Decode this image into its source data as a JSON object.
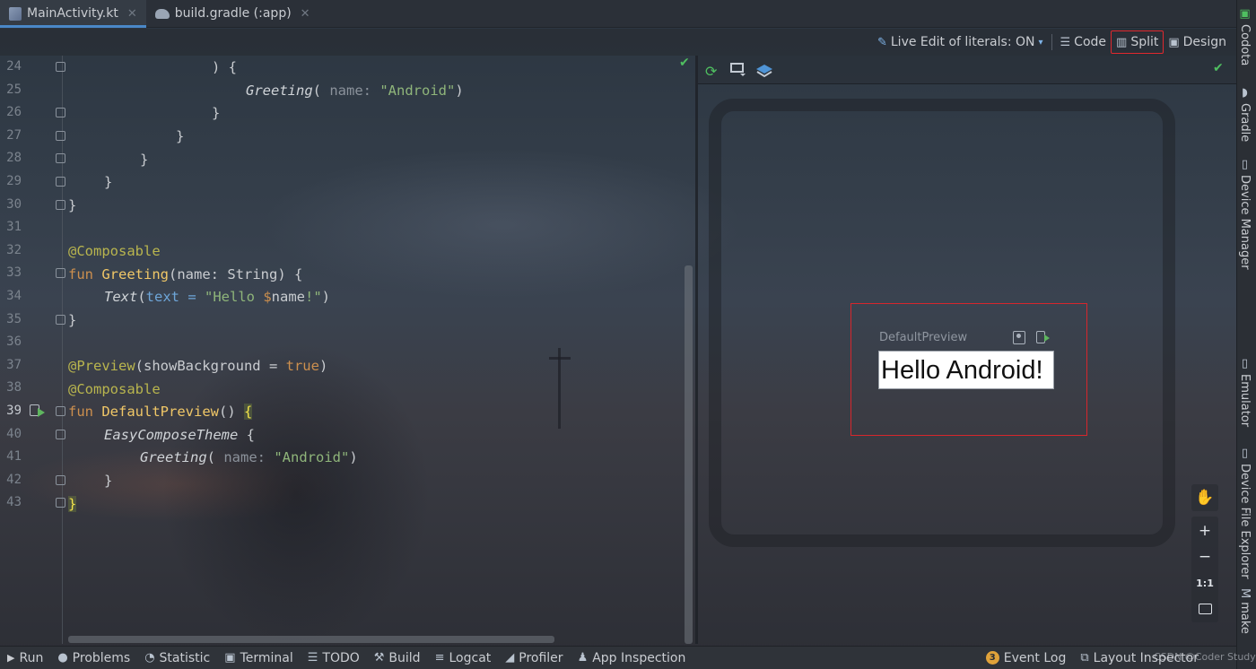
{
  "tabs": [
    {
      "label": "MainActivity.kt",
      "icon": "kotlin-file-icon",
      "active": true
    },
    {
      "label": "build.gradle (:app)",
      "icon": "gradle-icon",
      "active": false
    }
  ],
  "toolbar": {
    "live_edit": "Live Edit of literals: ON",
    "code": "Code",
    "split": "Split",
    "design": "Design"
  },
  "editor": {
    "current_line": "39",
    "lines": [
      {
        "n": "24",
        "fold": true
      },
      {
        "n": "25",
        "fold": false
      },
      {
        "n": "26",
        "fold": true
      },
      {
        "n": "27",
        "fold": true
      },
      {
        "n": "28",
        "fold": true
      },
      {
        "n": "29",
        "fold": true
      },
      {
        "n": "30",
        "fold": true
      },
      {
        "n": "31",
        "fold": false
      },
      {
        "n": "32",
        "fold": false
      },
      {
        "n": "33",
        "fold": true
      },
      {
        "n": "34",
        "fold": false
      },
      {
        "n": "35",
        "fold": true
      },
      {
        "n": "36",
        "fold": false
      },
      {
        "n": "37",
        "fold": false
      },
      {
        "n": "38",
        "fold": false
      },
      {
        "n": "39",
        "fold": true,
        "run": true
      },
      {
        "n": "40",
        "fold": true
      },
      {
        "n": "41",
        "fold": false
      },
      {
        "n": "42",
        "fold": true
      },
      {
        "n": "43",
        "fold": true
      }
    ],
    "code": {
      "l24": ") {",
      "l25_fn": "Greeting",
      "l25_open": "( ",
      "l25_hint": "name: ",
      "l25_str": "\"Android\"",
      "l25_close": ")",
      "brace": "}",
      "ann_composable": "@Composable",
      "kw_fun": "fun",
      "l33_fn": "Greeting",
      "l33_rest": "(name: String) {",
      "l34_fn": "Text",
      "l34_param": "text",
      "l34_eq": " = ",
      "l34_str1": "\"Hello ",
      "l34_tmpl": "$",
      "l34_var": "name",
      "l34_str2": "!\"",
      "l34_close": ")",
      "ann_preview": "@Preview",
      "l37_open": "(showBackground = ",
      "l37_true": "true",
      "l37_close": ")",
      "l39_fn": "DefaultPreview",
      "l39_paren": "() ",
      "l39_brace": "{",
      "l40_fn": "EasyComposeTheme",
      "l40_rest": " {",
      "l41_fn": "Greeting",
      "l41_open": "( ",
      "l41_hint": "name: ",
      "l41_str": "\"Android\"",
      "l41_close": ")",
      "l43_brace": "}"
    }
  },
  "preview": {
    "name": "DefaultPreview",
    "text": "Hello Android!",
    "zoom_hand": "hand-icon",
    "zoom_in": "+",
    "zoom_out": "−",
    "zoom_1to1": "1:1"
  },
  "right_tabs": [
    "Codota",
    "Gradle",
    "Device Manager",
    "Emulator",
    "Device File Explorer",
    "make"
  ],
  "status_bar": {
    "run": "Run",
    "problems": "Problems",
    "statistic": "Statistic",
    "terminal": "Terminal",
    "todo": "TODO",
    "build": "Build",
    "logcat": "Logcat",
    "profiler": "Profiler",
    "app_inspection": "App Inspection",
    "event_log_count": "3",
    "event_log": "Event Log",
    "layout_inspector": "Layout Inspector"
  },
  "watermark": "CSDN @Coder Study",
  "colors": {
    "accent": "#4a88c7",
    "highlight_box": "#e0282e",
    "keyword": "#cc8f4e",
    "annotation": "#b9b54e",
    "function": "#f0c767",
    "string": "#8fb57a",
    "success": "#4fbf60"
  }
}
